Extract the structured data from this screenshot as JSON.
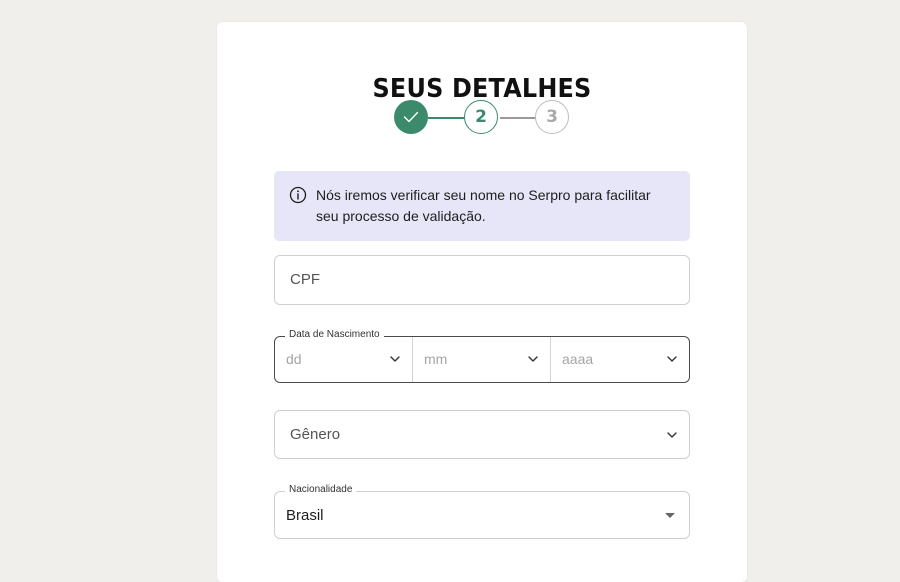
{
  "header": {
    "title": "SEUS DETALHES"
  },
  "stepper": {
    "steps": [
      {
        "label": "",
        "state": "completed"
      },
      {
        "label": "2",
        "state": "current"
      },
      {
        "label": "3",
        "state": "upcoming"
      }
    ]
  },
  "info_banner": {
    "icon": "info-icon",
    "text": "Nós iremos verificar seu nome no Serpro para facilitar seu processo de validação."
  },
  "form": {
    "cpf": {
      "placeholder": "CPF",
      "value": ""
    },
    "birthdate": {
      "legend": "Data de Nascimento",
      "day": {
        "placeholder": "dd"
      },
      "month": {
        "placeholder": "mm"
      },
      "year": {
        "placeholder": "aaaa"
      }
    },
    "gender": {
      "placeholder": "Gênero"
    },
    "nationality": {
      "legend": "Nacionalidade",
      "value": "Brasil"
    }
  },
  "colors": {
    "accent": "#3b8a6b",
    "info_bg": "#e6e6f8",
    "page_bg": "#f1efeb"
  }
}
